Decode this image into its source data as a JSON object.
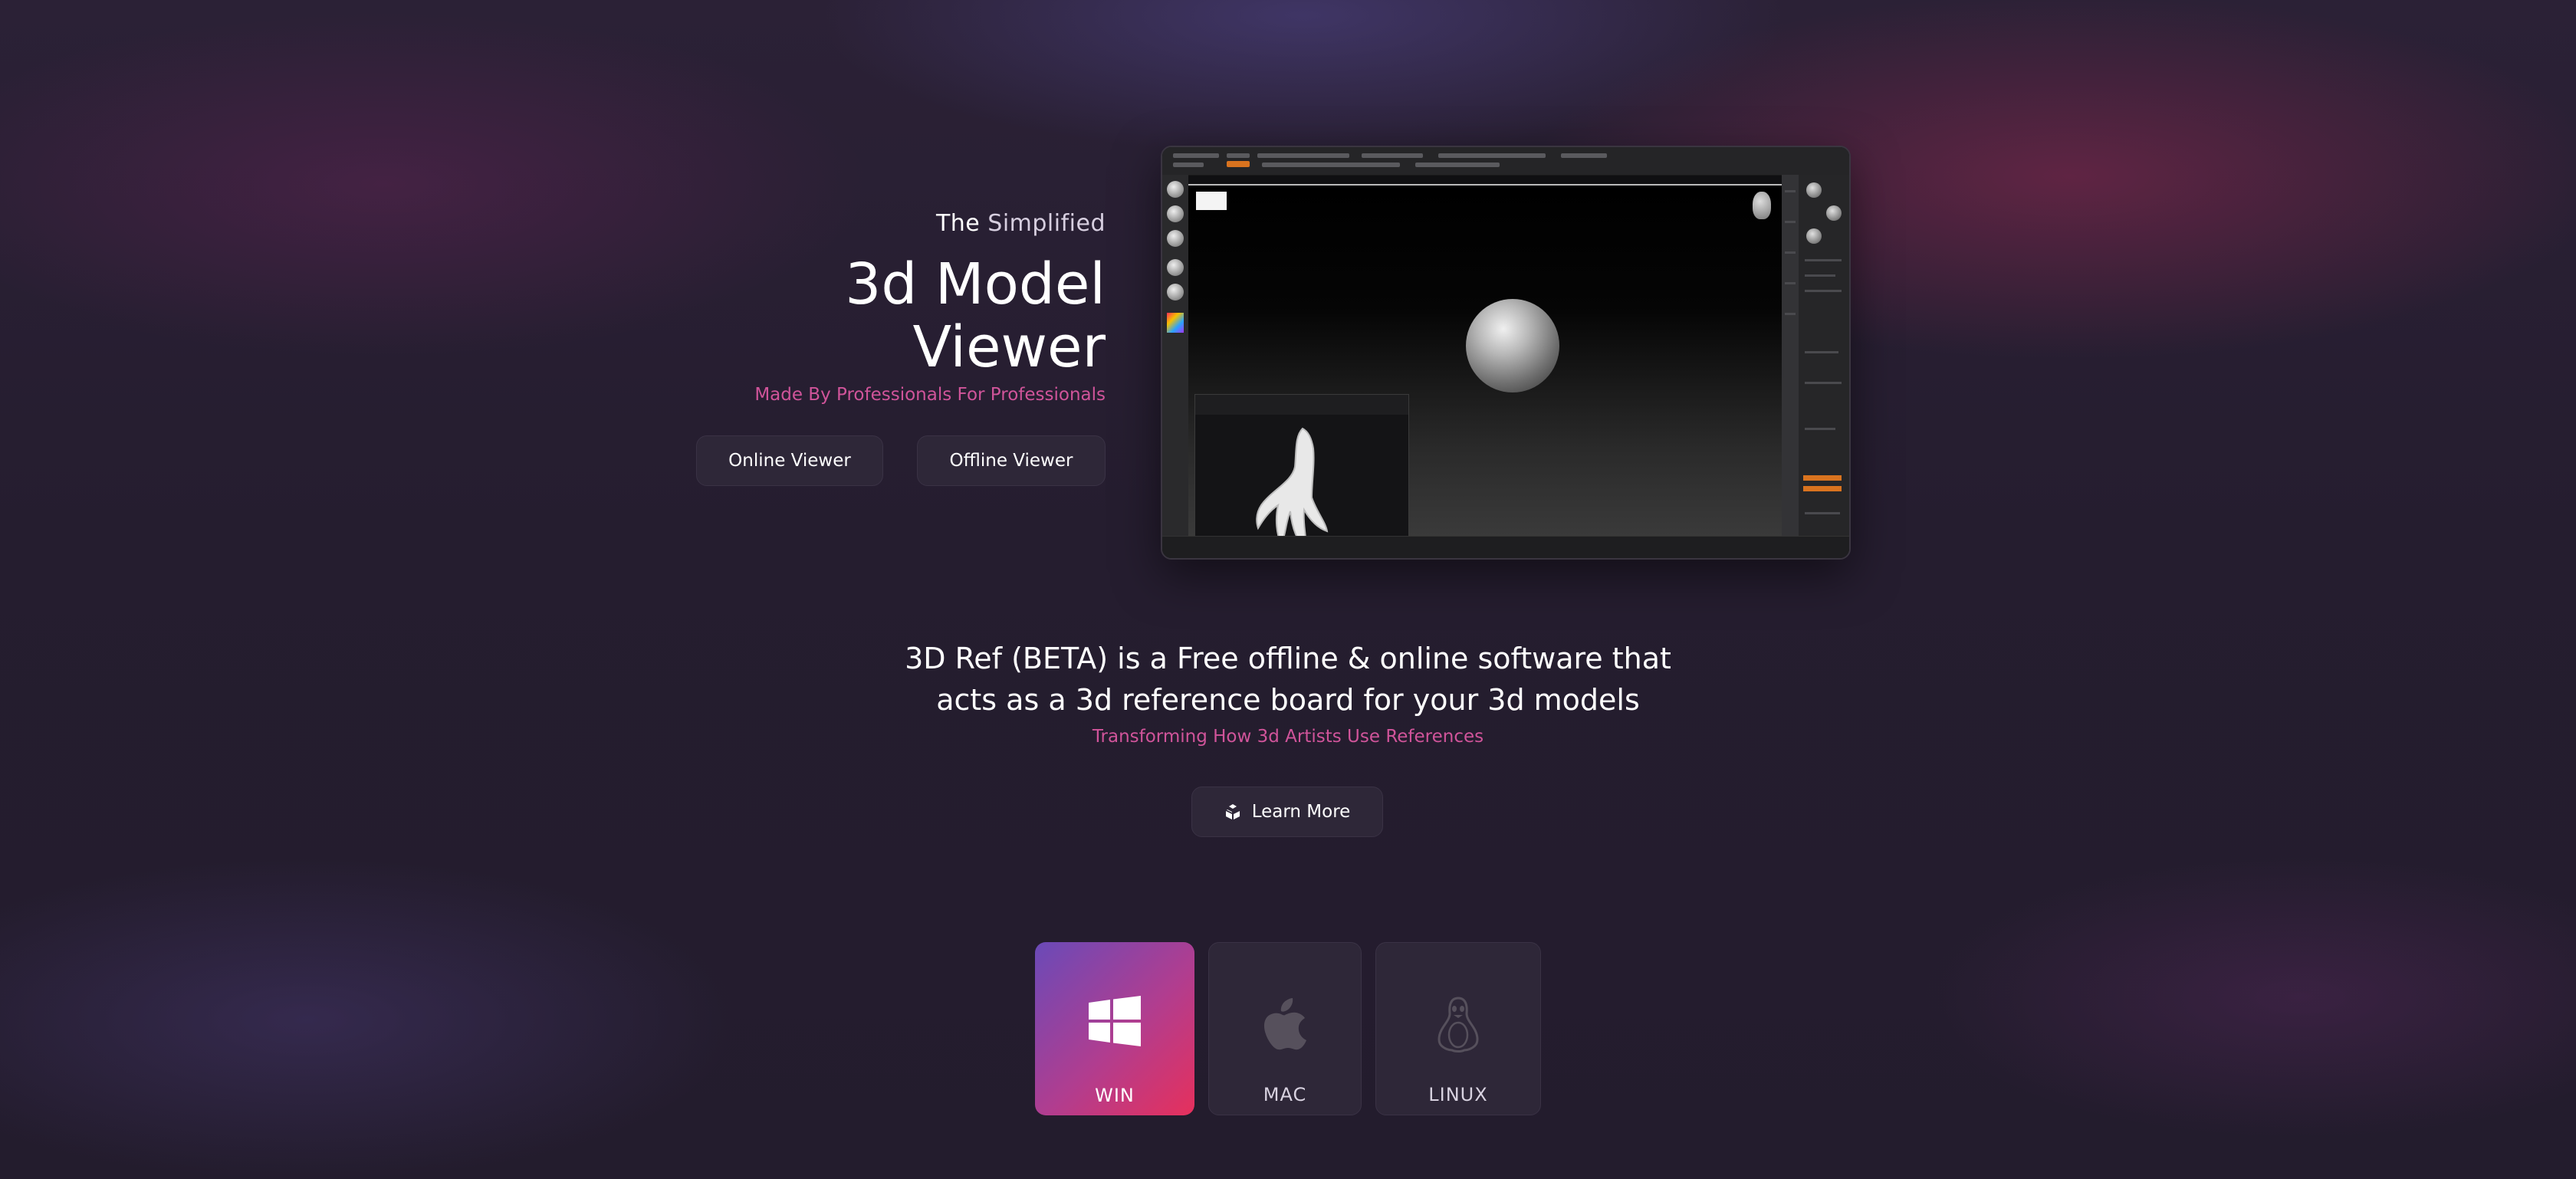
{
  "hero": {
    "kicker_the": "The",
    "kicker_simplified": "Simplified",
    "title_line1": "3d Model",
    "title_line2": "Viewer",
    "tagline": "Made By Professionals For Professionals",
    "buttons": {
      "online": "Online Viewer",
      "offline": "Offline Viewer"
    }
  },
  "description": {
    "lead": "3D Ref (BETA) is a Free offline & online software that acts as a 3d reference board for your 3d models",
    "sub": "Transforming How 3d Artists Use References",
    "learn_more": "Learn More"
  },
  "platforms": [
    {
      "label": "WIN",
      "icon": "windows-icon",
      "active": true
    },
    {
      "label": "MAC",
      "icon": "apple-icon",
      "active": false
    },
    {
      "label": "LINUX",
      "icon": "linux-tux-icon",
      "active": false
    }
  ],
  "colors": {
    "accent_pink": "#d0549a",
    "win_gradient_start": "#6a4ab8",
    "win_gradient_end": "#e6305c",
    "card_bg": "#2e2738",
    "page_bg": "#251d2f"
  }
}
